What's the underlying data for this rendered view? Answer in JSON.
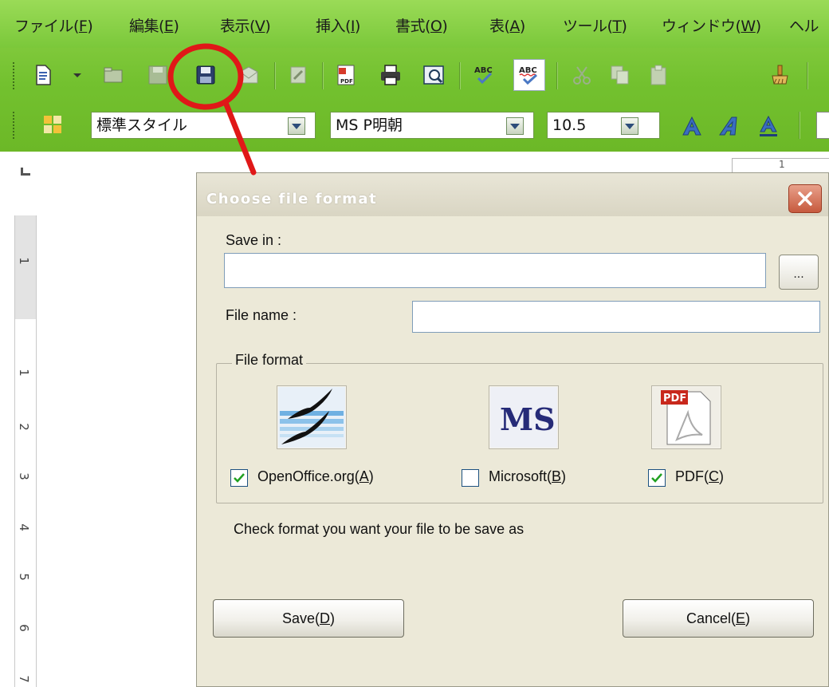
{
  "menubar": {
    "items": [
      {
        "label": "ファイル(",
        "key": "F",
        "end": ")"
      },
      {
        "label": "編集(",
        "key": "E",
        "end": ")"
      },
      {
        "label": "表示(",
        "key": "V",
        "end": ")"
      },
      {
        "label": "挿入(",
        "key": "I",
        "end": ")"
      },
      {
        "label": "書式(",
        "key": "O",
        "end": ")"
      },
      {
        "label": "表(",
        "key": "A",
        "end": ")"
      },
      {
        "label": "ツール(",
        "key": "T",
        "end": ")"
      },
      {
        "label": "ウィンドウ(",
        "key": "W",
        "end": ")"
      },
      {
        "label": "ヘル",
        "key": "",
        "end": ""
      }
    ]
  },
  "toolbar": {
    "icons": [
      "new-document-icon",
      "dropdown-arrow-icon",
      "open-folder-icon",
      "save-icon",
      "save-format-icon",
      "email-icon",
      "edit-file-icon",
      "export-pdf-icon",
      "print-icon",
      "print-preview-icon",
      "spellcheck-icon",
      "autospellcheck-icon",
      "cut-icon",
      "copy-icon",
      "paste-icon",
      "format-paintbrush-icon"
    ]
  },
  "format_bar": {
    "style_value": "標準スタイル",
    "font_value": "MS P明朝",
    "size_value": "10.5"
  },
  "ruler": {
    "marks": [
      "1",
      "1",
      "2",
      "3",
      "4",
      "5",
      "6",
      "7"
    ],
    "page_indicator": "1"
  },
  "dialog": {
    "title": "Choose file format",
    "save_in_label": "Save in :",
    "save_in_value": "",
    "browse_label": "...",
    "file_name_label": "File name :",
    "file_name_value": "",
    "file_format_legend": "File format",
    "formats": [
      {
        "label": "OpenOffice.org(",
        "key": "A",
        "end": ")",
        "checked": true,
        "icon": "openoffice-gulls-icon"
      },
      {
        "label": "Microsoft(",
        "key": "B",
        "end": ")",
        "checked": false,
        "icon": "ms-logo-icon"
      },
      {
        "label": "PDF(",
        "key": "C",
        "end": ")",
        "checked": true,
        "icon": "pdf-document-icon"
      }
    ],
    "ms_icon_text": "MS",
    "pdf_icon_text": "PDF",
    "hint": "Check format you want your file to be save as",
    "save_button": {
      "label": "Save(",
      "key": "D",
      "end": ")"
    },
    "cancel_button": {
      "label": "Cancel(",
      "key": "E",
      "end": ")"
    }
  },
  "colors": {
    "chrome_green": "#7bc83a",
    "dialog_bg": "#ece9d8",
    "annotation_red": "#e01818",
    "checkbox_check": "#21a121"
  }
}
